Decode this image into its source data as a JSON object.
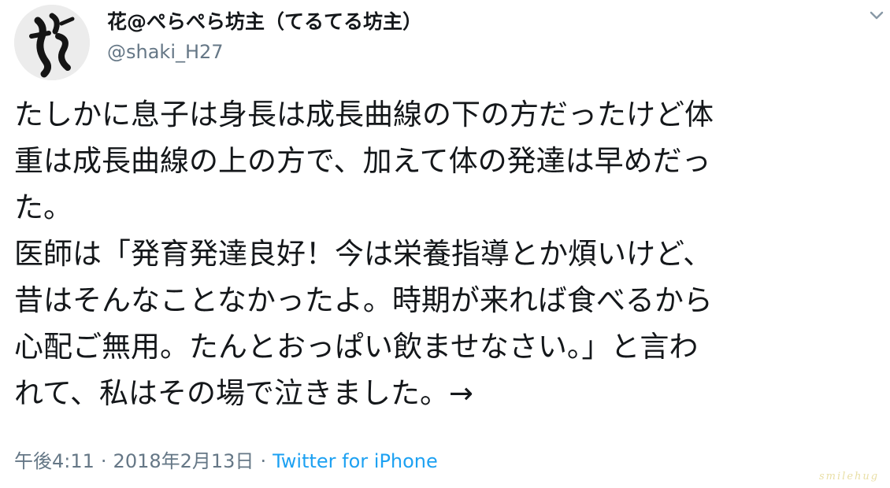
{
  "tweet": {
    "display_name": "花@ぺらぺら坊主（てるてる坊主）",
    "handle": "@shaki_H27",
    "lines": [
      "たしかに息子は身長は成長曲線の下の方だったけど体",
      "重は成長曲線の上の方で、加えて体の発達は早めだっ",
      "た。",
      "医師は「発育発達良好！今は栄養指導とか煩いけど、",
      "昔はそんなことなかったよ。時期が来れば食べるから",
      "心配ご無用。たんとおっぱい飲ませなさい。」と言わ",
      "れて、私はその場で泣きました。→"
    ],
    "time": "午後4:11",
    "date": "2018年2月13日",
    "separator": "·",
    "source": "Twitter for iPhone"
  },
  "watermark": "smilehug",
  "icons": {
    "avatar": "calligraphy-flower-avatar",
    "menu": "chevron-down-icon"
  },
  "colors": {
    "text": "#14171a",
    "secondary": "#657786",
    "link": "#1da1f2"
  }
}
